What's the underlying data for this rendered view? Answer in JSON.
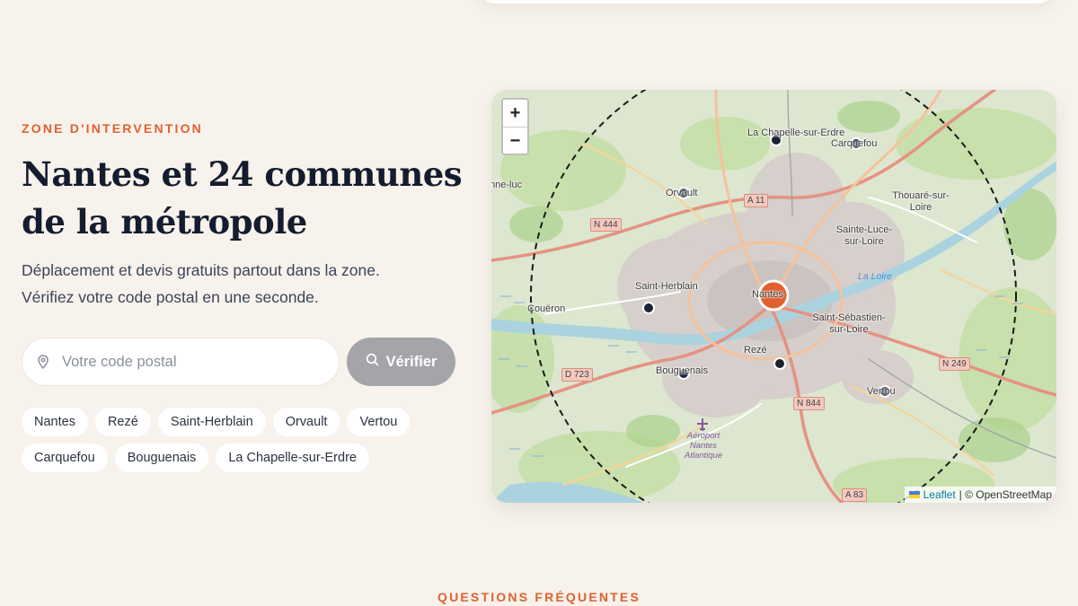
{
  "zone": {
    "eyebrow": "ZONE D'INTERVENTION",
    "title": "Nantes et 24 communes de la métropole",
    "lead_line1": "Déplacement et devis gratuits partout dans la zone.",
    "lead_line2": "Vérifiez votre code postal en une seconde.",
    "search_placeholder": "Votre code postal",
    "search_value": "",
    "verify_label": "Vérifier",
    "chips": [
      "Nantes",
      "Rezé",
      "Saint-Herblain",
      "Orvault",
      "Vertou",
      "Carquefou",
      "Bouguenais",
      "La Chapelle-sur-Erdre"
    ]
  },
  "map": {
    "zoom_in": "+",
    "zoom_out": "−",
    "attribution_link": "Leaflet",
    "attribution_text": "| © OpenStreetMap",
    "places": {
      "chapelle": "La Chapelle-sur-Erdre",
      "carquefou": "Carquefou",
      "orvault": "Orvault",
      "thouare": "Thouaré-sur-Loire",
      "sainte_luce": "Sainte-Luce-sur-Loire",
      "saint_herblain": "Saint-Herblain",
      "nantes": "Nantes",
      "coueron": "Couëron",
      "saint_sebastien": "Saint-Sébastien-sur-Loire",
      "reze": "Rezé",
      "bouguenais": "Bouguenais",
      "vertou": "Vertou",
      "edge_left": "nne-luc",
      "airport": "Aéroport Nantes Atlantique",
      "river": "La Loire"
    },
    "roads": {
      "a11": "A 11",
      "n444": "N 444",
      "d723": "D 723",
      "n249": "N 249",
      "n844": "N 844",
      "a83": "A 83"
    },
    "colors": {
      "center_marker": "#e0612f",
      "commune_marker": "#1a2233",
      "radius_line": "#1a1a1a"
    }
  },
  "faq": {
    "eyebrow": "QUESTIONS FRÉQUENTES"
  }
}
